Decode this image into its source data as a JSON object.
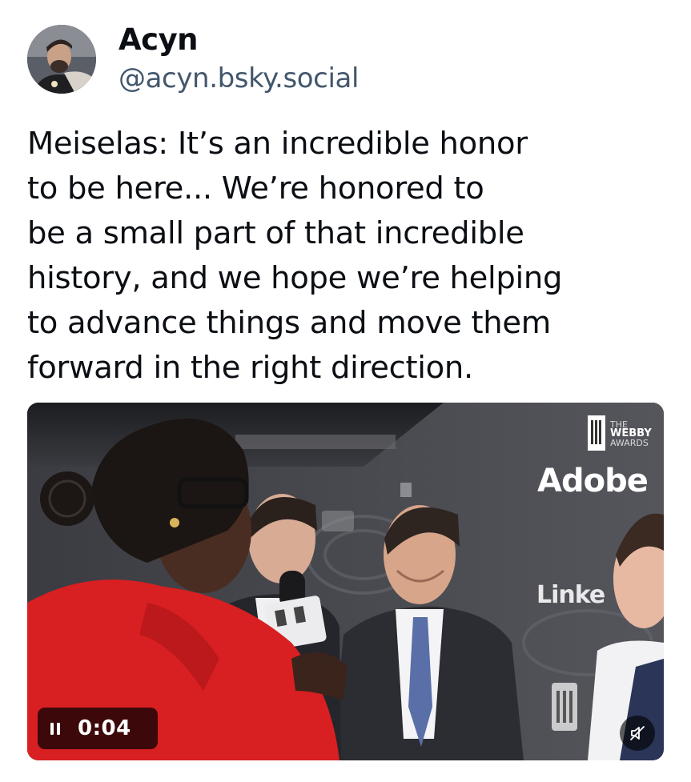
{
  "author": {
    "display_name": "Acyn",
    "handle": "@acyn.bsky.social",
    "avatar_icon": "profile-photo"
  },
  "post": {
    "text_lines": [
      "Meiselas: It’s an incredible honor",
      "to be here... We’re honored to",
      "be a small part of that incredible",
      "history, and we hope we’re helping",
      "to advance things and move them",
      "forward in the right direction."
    ]
  },
  "video": {
    "backdrop_logos": {
      "the": "THE",
      "webby": "WEBBY",
      "awards": "AWARDS",
      "adobe": "Adobe",
      "linkedin": "Linke"
    },
    "controls": {
      "pause_icon": "pause-icon",
      "timestamp": "0:04",
      "mute_icon": "muted-speaker-icon"
    }
  },
  "colors": {
    "text_primary": "#0b0f14",
    "handle": "#42576c",
    "overlay": "#000000"
  }
}
